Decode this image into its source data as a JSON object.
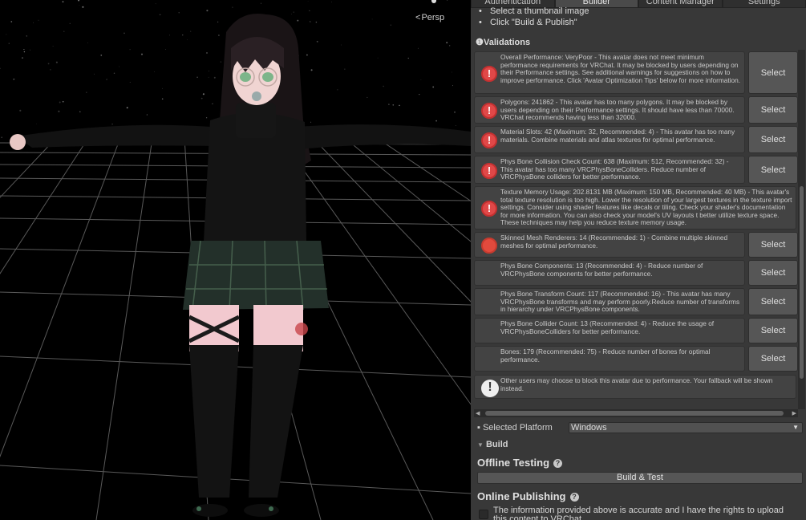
{
  "scene": {
    "view_mode": "Persp",
    "view_mode_icon": "perspective-arrow-icon"
  },
  "tabs": [
    "Authentication",
    "Builder",
    "Content Manager",
    "Settings"
  ],
  "active_tab": "Builder",
  "instructions": [
    "Select a thumbnail image",
    "Click \"Build & Publish\""
  ],
  "validations": {
    "title": "Validations",
    "icon": "info-icon",
    "items": [
      {
        "severity": "error",
        "icon": "error-icon",
        "text": "Overall Performance: VeryPoor - This avatar does not meet minimum performance requirements for VRChat. It may be blocked by users depending on their Performance settings. See additional warnings for suggestions on how to improve performance. Click 'Avatar Optimization Tips' below for more information.",
        "button": "Select"
      },
      {
        "severity": "error",
        "icon": "error-icon",
        "text": "Polygons: 241862 - This avatar has too many polygons. It may be blocked by users depending on their Performance settings. It should have less than 70000. VRChat recommends having less than 32000.",
        "button": "Select"
      },
      {
        "severity": "error",
        "icon": "error-icon",
        "text": "Material Slots: 42 (Maximum: 32, Recommended: 4) - This avatar has too many materials. Combine materials and atlas textures for optimal performance.",
        "button": "Select"
      },
      {
        "severity": "error",
        "icon": "error-icon",
        "text": "Phys Bone Collision Check Count: 638 (Maximum: 512, Recommended: 32) - This avatar has too many VRCPhysBoneColliders. Reduce number of VRCPhysBone colliders for better performance.",
        "button": "Select"
      },
      {
        "severity": "error",
        "icon": "error-icon",
        "text": "Texture Memory Usage: 202.8131 MB (Maximum: 150 MB, Recommended: 40 MB) - This avatar's total texture resolution is too high. Lower the resolution of your largest textures in the texture import settings. Consider using shader features like decals or tiling. Check your shader's documentation for more information. You can also check your model's UV layouts t better utilize texture space. These techniques may help you reduce texture memory usage.",
        "button": ""
      },
      {
        "severity": "error-solid",
        "icon": "error-circle-icon",
        "text": "Skinned Mesh Renderers: 14 (Recommended: 1) - Combine multiple skinned meshes for optimal performance.",
        "button": "Select"
      },
      {
        "severity": "warning",
        "icon": "warning-icon",
        "text": "Phys Bone Components: 13 (Recommended: 4) - Reduce number of VRCPhysBone components for better performance.",
        "button": "Select"
      },
      {
        "severity": "warning",
        "icon": "warning-icon",
        "text": "Phys Bone Transform Count: 117 (Recommended: 16) - This avatar has many VRCPhysBone transforms and may perform poorly.Reduce number of transforms in hierarchy under VRCPhysBone components.",
        "button": "Select"
      },
      {
        "severity": "warning",
        "icon": "warning-icon",
        "text": "Phys Bone Collider Count: 13 (Recommended: 4) - Reduce the usage of VRCPhysBoneColliders for better performance.",
        "button": "Select"
      },
      {
        "severity": "warning",
        "icon": "warning-icon",
        "text": "Bones: 179 (Recommended: 75) - Reduce number of bones for optimal performance.",
        "button": "Select"
      },
      {
        "severity": "info",
        "icon": "exclamation-icon",
        "text": "Other users may choose to block this avatar due to performance. Your fallback will be shown instead.",
        "button": ""
      }
    ]
  },
  "selected_platform": {
    "label": "Selected Platform",
    "value": "Windows"
  },
  "build": {
    "section": "Build",
    "offline_title": "Offline Testing",
    "build_test_label": "Build & Test",
    "online_title": "Online Publishing",
    "consent_text": "The information provided above is accurate and I have the rights to upload this content to VRChat"
  },
  "colors": {
    "panel_bg": "#383838",
    "error": "#e04848",
    "warning": "#e8b41c",
    "button_bg": "#565656"
  }
}
